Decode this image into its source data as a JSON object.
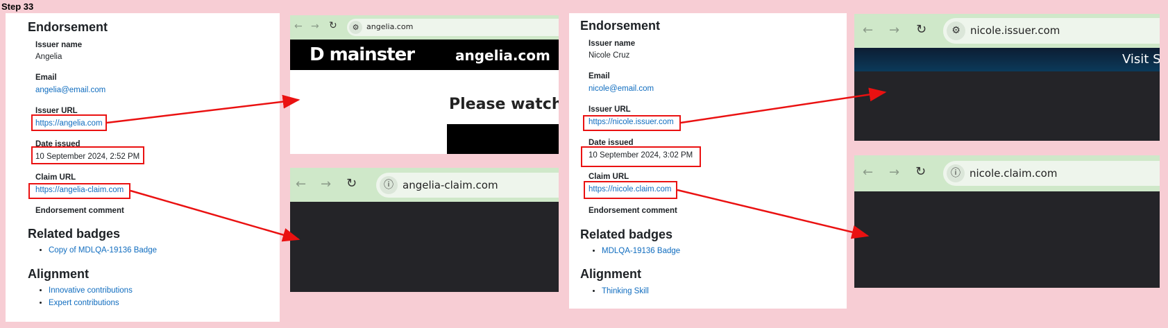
{
  "step_label": "Step 33",
  "left": {
    "heading": "Endorsement",
    "issuer_name_label": "Issuer name",
    "issuer_name": "Angelia",
    "email_label": "Email",
    "email": "angelia@email.com",
    "issuer_url_label": "Issuer URL",
    "issuer_url": "https://angelia.com",
    "date_label": "Date issued",
    "date": "10 September 2024, 2:52 PM",
    "claim_url_label": "Claim URL",
    "claim_url": "https://angelia-claim.com",
    "comment_label": "Endorsement comment",
    "related_heading": "Related badges",
    "related": [
      "Copy of MDLQA-19136 Badge"
    ],
    "alignment_heading": "Alignment",
    "alignment": [
      "Innovative contributions",
      "Expert contributions"
    ]
  },
  "right": {
    "heading": "Endorsement",
    "issuer_name_label": "Issuer name",
    "issuer_name": "Nicole Cruz",
    "email_label": "Email",
    "email": "nicole@email.com",
    "issuer_url_label": "Issuer URL",
    "issuer_url": "https://nicole.issuer.com",
    "date_label": "Date issued",
    "date": "10 September 2024, 3:02 PM",
    "claim_url_label": "Claim URL",
    "claim_url": "https://nicole.claim.com",
    "comment_label": "Endorsement comment",
    "related_heading": "Related badges",
    "related": [
      "MDLQA-19136 Badge"
    ],
    "alignment_heading": "Alignment",
    "alignment": [
      "Thinking Skill"
    ]
  },
  "shots": {
    "angelia": {
      "url": "angelia.com",
      "brand": "D mainster",
      "brand_domain": "angelia.com",
      "message": "Please watch c"
    },
    "angelia_claim": {
      "url": "angelia-claim.com"
    },
    "nicole_issuer": {
      "url": "nicole.issuer.com",
      "banner": "Visit S"
    },
    "nicole_claim": {
      "url": "nicole.claim.com"
    }
  },
  "icons": {
    "back": "back-arrow-icon",
    "forward": "forward-arrow-icon",
    "reload": "reload-icon",
    "site-settings": "tune-icon",
    "info": "info-icon"
  },
  "colors": {
    "background": "#f7cdd4",
    "link": "#0f6cbf",
    "highlight": "#ea1111",
    "toolbar": "#cfe8c9"
  }
}
